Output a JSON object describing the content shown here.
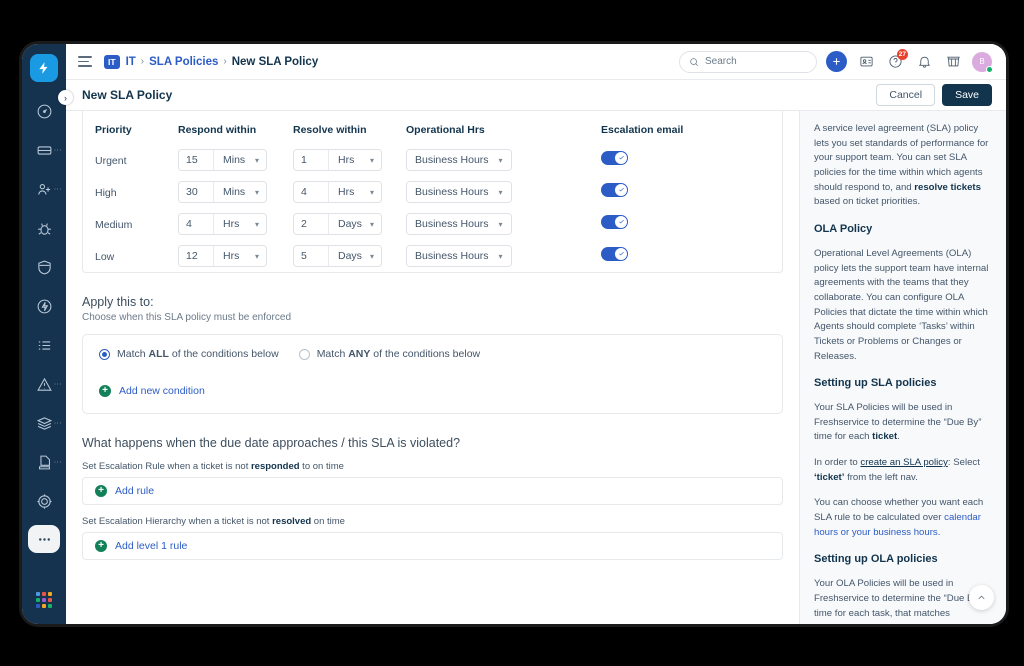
{
  "window": {
    "rail": {
      "logo_icon": "lightning-bolt-logo",
      "expand_icon": "chevron-right-icon",
      "items": [
        {
          "name": "dashboard",
          "icon": "speedometer-icon",
          "has_dots": false,
          "active": false
        },
        {
          "name": "tickets",
          "icon": "ticket-icon",
          "has_dots": true,
          "active": false
        },
        {
          "name": "requesters",
          "icon": "user-plus-icon",
          "has_dots": true,
          "active": false
        },
        {
          "name": "problems",
          "icon": "bug-icon",
          "has_dots": false,
          "active": false
        },
        {
          "name": "changes",
          "icon": "shield-icon",
          "has_dots": false,
          "active": false
        },
        {
          "name": "releases",
          "icon": "bolt-circle-icon",
          "has_dots": false,
          "active": false
        },
        {
          "name": "tasks",
          "icon": "checklist-icon",
          "has_dots": false,
          "active": false
        },
        {
          "name": "alerts",
          "icon": "warning-triangle-icon",
          "has_dots": true,
          "active": false
        },
        {
          "name": "assets",
          "icon": "layers-icon",
          "has_dots": true,
          "active": false
        },
        {
          "name": "contracts",
          "icon": "document-icon",
          "has_dots": true,
          "active": false
        },
        {
          "name": "projects",
          "icon": "target-icon",
          "has_dots": false,
          "active": false
        },
        {
          "name": "more",
          "icon": "ellipsis-icon",
          "has_dots": false,
          "active": true
        }
      ],
      "grid_colors": [
        "#4a9ae1",
        "#e8564a",
        "#f5a623",
        "#12b26a",
        "#9b59d0",
        "#e8564a",
        "#2c5cc5",
        "#f5a623",
        "#12b26a"
      ]
    },
    "topbar": {
      "menu_icon": "hamburger-icon",
      "workspace_badge": "IT",
      "breadcrumb": [
        {
          "label": "IT",
          "type": "link"
        },
        {
          "label": "SLA Policies",
          "type": "link"
        },
        {
          "label": "New SLA Policy",
          "type": "current"
        }
      ],
      "separator": "›",
      "search": {
        "placeholder": "Search",
        "icon": "search-icon"
      },
      "add_button": {
        "icon": "plus-icon",
        "label": "+"
      },
      "icons": [
        {
          "name": "contact-card-icon",
          "badge": null
        },
        {
          "name": "help-circle-icon",
          "badge": "27"
        },
        {
          "name": "bell-icon",
          "badge": null
        },
        {
          "name": "marketplace-icon",
          "badge": null
        }
      ],
      "avatar": {
        "initial": "B",
        "status": "online"
      }
    },
    "page_header": {
      "title": "New SLA Policy",
      "cancel_label": "Cancel",
      "save_label": "Save"
    },
    "sla_table": {
      "headers": {
        "priority": "Priority",
        "respond_within": "Respond within",
        "resolve_within": "Resolve within",
        "operational_hrs": "Operational Hrs",
        "escalation_email": "Escalation email"
      },
      "rows": [
        {
          "priority": "Urgent",
          "respond_value": "15",
          "respond_unit": "Mins",
          "resolve_value": "1",
          "resolve_unit": "Hrs",
          "operational_hrs": "Business Hours",
          "escalation_email": true
        },
        {
          "priority": "High",
          "respond_value": "30",
          "respond_unit": "Mins",
          "resolve_value": "4",
          "resolve_unit": "Hrs",
          "operational_hrs": "Business Hours",
          "escalation_email": true
        },
        {
          "priority": "Medium",
          "respond_value": "4",
          "respond_unit": "Hrs",
          "resolve_value": "2",
          "resolve_unit": "Days",
          "operational_hrs": "Business Hours",
          "escalation_email": true
        },
        {
          "priority": "Low",
          "respond_value": "12",
          "respond_unit": "Hrs",
          "resolve_value": "5",
          "resolve_unit": "Days",
          "operational_hrs": "Business Hours",
          "escalation_email": true
        }
      ]
    },
    "apply_section": {
      "title": "Apply this to:",
      "subtitle": "Choose when this SLA policy must be enforced",
      "match_all_pre": "Match ",
      "match_all_bold": "ALL",
      "match_all_post": " of the conditions below",
      "match_any_pre": "Match ",
      "match_any_bold": "ANY",
      "match_any_post": " of the conditions below",
      "selected": "all",
      "add_condition_label": "Add new condition"
    },
    "escalation_section": {
      "title": "What happens when the due date approaches / this SLA is violated?",
      "rule_label_pre": "Set Escalation Rule when a ticket is not ",
      "rule_label_bold": "responded",
      "rule_label_post": " to on time",
      "add_rule_label": "Add rule",
      "hierarchy_label_pre": "Set Escalation Hierarchy when a ticket is not ",
      "hierarchy_label_bold": "resolved",
      "hierarchy_label_post": " on time",
      "add_level_rule_label": "Add level 1 rule"
    },
    "help_panel": {
      "intro_part1": "A service level agreement (SLA) policy lets you set standards of performance for your support team. You can set SLA policies for the time within which agents should respond to, and ",
      "intro_bold": "resolve tickets",
      "intro_part2": " based on ticket priorities.",
      "ola_heading": "OLA Policy",
      "ola_body": "Operational Level Agreements (OLA) policy lets the support team have internal agreements with the teams that they collaborate. You can configure OLA Policies that dictate the time within which Agents should complete ‘Tasks’ within Tickets or Problems or Changes or Releases.",
      "sla_setup_heading": "Setting up SLA policies",
      "sla_setup_part1": "Your SLA Policies will be used in Freshservice to determine the “Due By” time for each ",
      "sla_setup_bold": "ticket",
      "sla_setup_part2": ".",
      "order_part1": "In order to ",
      "order_link": "create an SLA policy",
      "order_part2": ": Select ",
      "order_bold": "‘ticket’",
      "order_part3": " from the left nav.",
      "calendar_part1": "You can choose whether you want each SLA rule to be calculated over ",
      "calendar_link": "calendar hours or your business hours.",
      "ola_setup_heading": "Setting up OLA policies",
      "ola_setup_body": "Your OLA Policies will be used in Freshservice to determine the “Due By” time for each task, that matches",
      "scroll_top_icon": "chevron-up-icon"
    }
  }
}
